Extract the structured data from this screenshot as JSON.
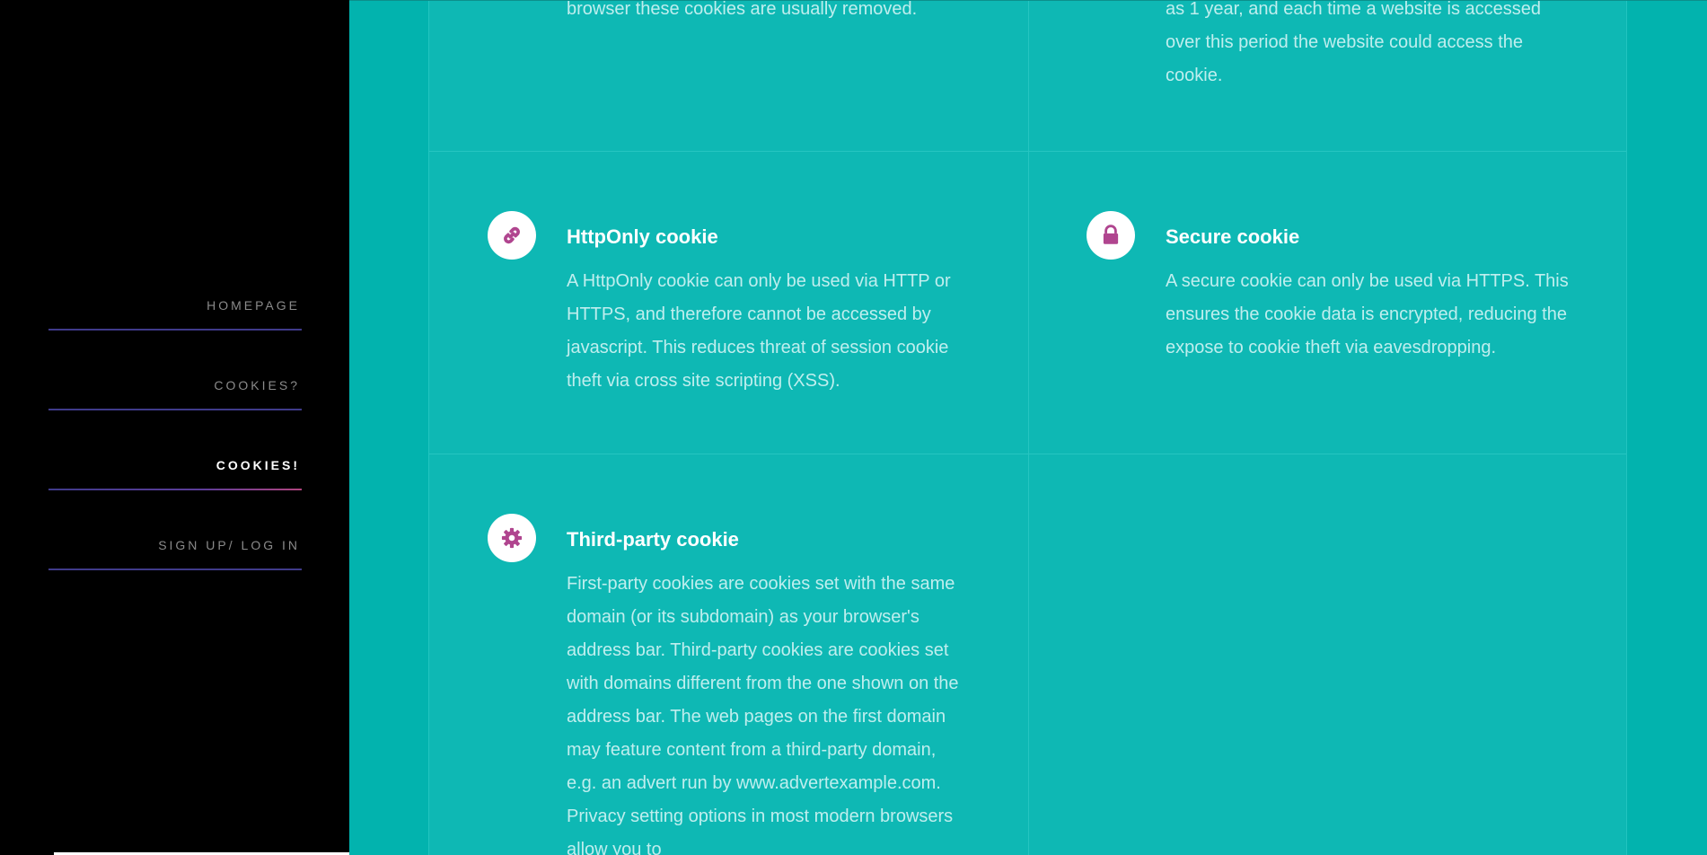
{
  "sidebar": {
    "nav": [
      {
        "label": "HOMEPAGE",
        "active": false
      },
      {
        "label": "COOKIES?",
        "active": false
      },
      {
        "label": "COOKIES!",
        "active": true
      },
      {
        "label": "SIGN UP/ LOG IN",
        "active": false
      }
    ]
  },
  "top_row": {
    "left_text": "browser these cookies are usually removed.",
    "right_text_lines": "as 1 year, and each time a website is accessed over this period the website could access the cookie."
  },
  "cards": [
    {
      "icon": "link-icon",
      "title": "HttpOnly cookie",
      "description": "A HttpOnly cookie can only be used via HTTP or HTTPS, and therefore cannot be accessed by javascript. This reduces threat of session cookie theft via cross site scripting (XSS)."
    },
    {
      "icon": "lock-icon",
      "title": "Secure cookie",
      "description": "A secure cookie can only be used via HTTPS. This ensures the cookie data is encrypted, reducing the expose to cookie theft via eavesdropping."
    },
    {
      "icon": "gear-icon",
      "title": "Third-party cookie",
      "description": "First-party cookies are cookies set with the same domain (or its subdomain) as your browser's address bar. Third-party cookies are cookies set with domains different from the one shown on the address bar. The web pages on the first domain may feature content from a third-party domain, e.g. an advert run by www.advertexample.com. Privacy setting options in most modern browsers allow you to"
    }
  ],
  "colors": {
    "teal_bg": "#02b3ae",
    "teal_panel": "#0eb8b4",
    "icon_accent": "#b0458f",
    "nav_line": "#3f3a8a"
  }
}
